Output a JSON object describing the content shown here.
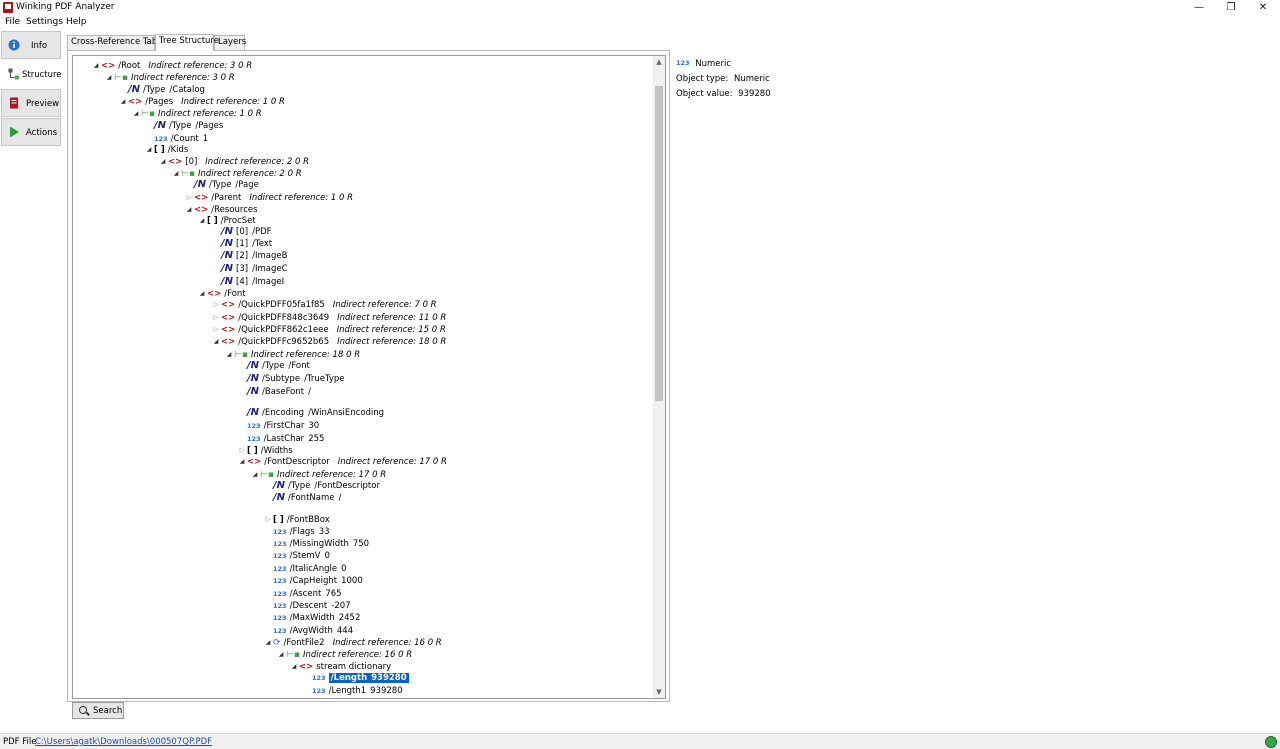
{
  "app": {
    "title": "Winking PDF Analyzer"
  },
  "window_controls": {
    "minimize": "—",
    "restore": "❐",
    "close": "✕"
  },
  "menu": [
    "File",
    "Settings",
    "Help"
  ],
  "sidebar": [
    {
      "label": "Info",
      "icon": "info-icon"
    },
    {
      "label": "Structure",
      "icon": "structure-icon"
    },
    {
      "label": "Preview",
      "icon": "preview-icon"
    },
    {
      "label": "Actions",
      "icon": "play-icon"
    }
  ],
  "tabs": [
    "Cross-Reference Table",
    "Tree Structure",
    "Layers"
  ],
  "active_tab": "Tree Structure",
  "tree": [
    {
      "exp": "open",
      "icon": "dict",
      "key": "/Root",
      "ref": "Indirect reference: 3 0 R"
    },
    {
      "exp": "open",
      "icon": "ref",
      "key": "",
      "ref": "Indirect reference: 3 0 R"
    },
    {
      "exp": "",
      "icon": "name",
      "key": "/Type",
      "value": "/Catalog"
    },
    {
      "exp": "open",
      "icon": "dict",
      "key": "/Pages",
      "ref": "Indirect reference: 1 0 R"
    },
    {
      "exp": "open",
      "icon": "ref",
      "key": "",
      "ref": "Indirect reference: 1 0 R"
    },
    {
      "exp": "",
      "icon": "name",
      "key": "/Type",
      "value": "/Pages"
    },
    {
      "exp": "",
      "icon": "num",
      "key": "/Count",
      "value": "1"
    },
    {
      "exp": "open",
      "icon": "arr",
      "key": "/Kids"
    },
    {
      "exp": "open",
      "icon": "dict",
      "key": "[0]",
      "ref": "Indirect reference: 2 0 R"
    },
    {
      "exp": "open",
      "icon": "ref",
      "key": "",
      "ref": "Indirect reference: 2 0 R"
    },
    {
      "exp": "",
      "icon": "name",
      "key": "/Type",
      "value": "/Page"
    },
    {
      "exp": "closed",
      "icon": "dict",
      "key": "/Parent",
      "ref": "Indirect reference: 1 0 R"
    },
    {
      "exp": "open",
      "icon": "dict",
      "key": "/Resources"
    },
    {
      "exp": "open",
      "icon": "arr",
      "key": "/ProcSet"
    },
    {
      "exp": "",
      "icon": "name",
      "key": "[0]",
      "value": "/PDF"
    },
    {
      "exp": "",
      "icon": "name",
      "key": "[1]",
      "value": "/Text"
    },
    {
      "exp": "",
      "icon": "name",
      "key": "[2]",
      "value": "/ImageB"
    },
    {
      "exp": "",
      "icon": "name",
      "key": "[3]",
      "value": "/ImageC"
    },
    {
      "exp": "",
      "icon": "name",
      "key": "[4]",
      "value": "/ImageI"
    },
    {
      "exp": "open",
      "icon": "dict",
      "key": "/Font"
    },
    {
      "exp": "closed",
      "icon": "dict",
      "key": "/QuickPDFF05fa1f85",
      "ref": "Indirect reference: 7 0 R"
    },
    {
      "exp": "closed",
      "icon": "dict",
      "key": "/QuickPDFF848c3649",
      "ref": "Indirect reference: 11 0 R"
    },
    {
      "exp": "closed",
      "icon": "dict",
      "key": "/QuickPDFF862c1eee",
      "ref": "Indirect reference: 15 0 R"
    },
    {
      "exp": "open",
      "icon": "dict",
      "key": "/QuickPDFFc9652b65",
      "ref": "Indirect reference: 18 0 R"
    },
    {
      "exp": "open",
      "icon": "ref",
      "key": "",
      "ref": "Indirect reference: 18 0 R"
    },
    {
      "exp": "",
      "icon": "name",
      "key": "/Type",
      "value": "/Font"
    },
    {
      "exp": "",
      "icon": "name",
      "key": "/Subtype",
      "value": "/TrueType"
    },
    {
      "exp": "",
      "icon": "name",
      "key": "/BaseFont",
      "value": "/"
    },
    {
      "exp": "",
      "icon": "name",
      "key": "/Encoding",
      "value": "/WinAnsiEncoding"
    },
    {
      "exp": "",
      "icon": "num",
      "key": "/FirstChar",
      "value": "30"
    },
    {
      "exp": "",
      "icon": "num",
      "key": "/LastChar",
      "value": "255"
    },
    {
      "exp": "closed",
      "icon": "arr",
      "key": "/Widths"
    },
    {
      "exp": "open",
      "icon": "dict",
      "key": "/FontDescriptor",
      "ref": "Indirect reference: 17 0 R"
    },
    {
      "exp": "open",
      "icon": "ref",
      "key": "",
      "ref": "Indirect reference: 17 0 R"
    },
    {
      "exp": "",
      "icon": "name",
      "key": "/Type",
      "value": "/FontDescriptor"
    },
    {
      "exp": "",
      "icon": "name",
      "key": "/FontName",
      "value": "/"
    },
    {
      "exp": "closed",
      "icon": "arr",
      "key": "/FontBBox"
    },
    {
      "exp": "",
      "icon": "num",
      "key": "/Flags",
      "value": "33"
    },
    {
      "exp": "",
      "icon": "num",
      "key": "/MissingWidth",
      "value": "750"
    },
    {
      "exp": "",
      "icon": "num",
      "key": "/StemV",
      "value": "0"
    },
    {
      "exp": "",
      "icon": "num",
      "key": "/ItalicAngle",
      "value": "0"
    },
    {
      "exp": "",
      "icon": "num",
      "key": "/CapHeight",
      "value": "1000"
    },
    {
      "exp": "",
      "icon": "num",
      "key": "/Ascent",
      "value": "765"
    },
    {
      "exp": "",
      "icon": "num",
      "key": "/Descent",
      "value": "-207"
    },
    {
      "exp": "",
      "icon": "num",
      "key": "/MaxWidth",
      "value": "2452"
    },
    {
      "exp": "",
      "icon": "num",
      "key": "/AvgWidth",
      "value": "444"
    },
    {
      "exp": "open",
      "icon": "stream",
      "key": "/FontFile2",
      "ref": "Indirect reference: 16 0 R"
    },
    {
      "exp": "open",
      "icon": "ref",
      "key": "",
      "ref": "Indirect reference: 16 0 R"
    },
    {
      "exp": "open",
      "icon": "dict",
      "key": "stream dictionary"
    },
    {
      "exp": "",
      "icon": "num",
      "key": "/Length",
      "value": "939280",
      "selected": true
    },
    {
      "exp": "",
      "icon": "num",
      "key": "/Length1",
      "value": "939280"
    }
  ],
  "search_label": "Search",
  "detail": {
    "type_icon": "123",
    "type_title": "Numeric",
    "object_type_label": "Object type:",
    "object_type": "Numeric",
    "object_value_label": "Object value:",
    "object_value": "939280"
  },
  "status": {
    "label": "PDF File",
    "path": "C:\\Users\\agatk\\Downloads\\000507QP.PDF",
    "indicator_color": "#3aa545"
  }
}
